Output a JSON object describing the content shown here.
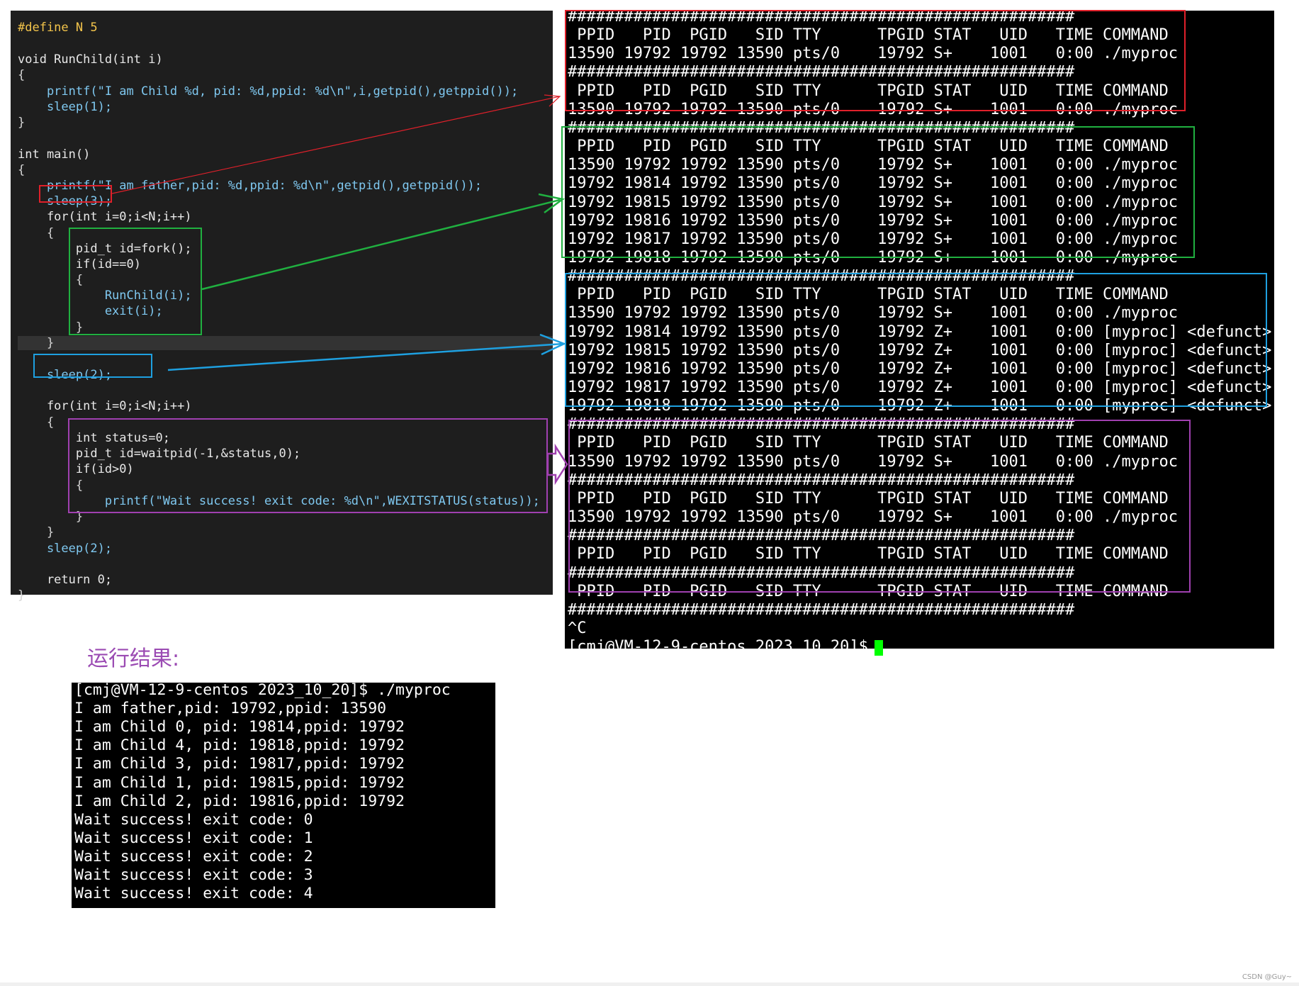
{
  "code": {
    "lines": [
      {
        "t": "#define N 5"
      },
      {
        "t": ""
      },
      {
        "t": "void RunChild(int i)"
      },
      {
        "t": "{"
      },
      {
        "t": "    printf(\"I am Child %d, pid: %d,ppid: %d\\n\",i,getpid(),getppid());"
      },
      {
        "t": "    sleep(1);"
      },
      {
        "t": "}"
      },
      {
        "t": ""
      },
      {
        "t": "int main()"
      },
      {
        "t": "{"
      },
      {
        "t": "    printf(\"I am father,pid: %d,ppid: %d\\n\",getpid(),getppid());"
      },
      {
        "t": "    sleep(3);"
      },
      {
        "t": "    for(int i=0;i<N;i++)"
      },
      {
        "t": "    {"
      },
      {
        "t": "        pid_t id=fork();"
      },
      {
        "t": "        if(id==0)"
      },
      {
        "t": "        {"
      },
      {
        "t": "            RunChild(i);"
      },
      {
        "t": "            exit(i);"
      },
      {
        "t": "        }"
      },
      {
        "t": ""
      },
      {
        "t": "    }"
      },
      {
        "t": "    sleep(2);"
      },
      {
        "t": ""
      },
      {
        "t": "    for(int i=0;i<N;i++)"
      },
      {
        "t": "    {"
      },
      {
        "t": "        int status=0;"
      },
      {
        "t": "        pid_t id=waitpid(-1,&status,0);"
      },
      {
        "t": "        if(id>0)"
      },
      {
        "t": "        {"
      },
      {
        "t": "            printf(\"Wait success! exit code: %d\\n\",WEXITSTATUS(status));"
      },
      {
        "t": "        }"
      },
      {
        "t": "    }"
      },
      {
        "t": "    sleep(2);"
      },
      {
        "t": ""
      },
      {
        "t": "    return 0;"
      },
      {
        "t": "}"
      }
    ]
  },
  "ps": {
    "lines": [
      "######################################################",
      " PPID   PID  PGID   SID TTY      TPGID STAT   UID   TIME COMMAND",
      "13590 19792 19792 13590 pts/0    19792 S+    1001   0:00 ./myproc",
      "######################################################",
      " PPID   PID  PGID   SID TTY      TPGID STAT   UID   TIME COMMAND",
      "13590 19792 19792 13590 pts/0    19792 S+    1001   0:00 ./myproc",
      "######################################################",
      " PPID   PID  PGID   SID TTY      TPGID STAT   UID   TIME COMMAND",
      "13590 19792 19792 13590 pts/0    19792 S+    1001   0:00 ./myproc",
      "19792 19814 19792 13590 pts/0    19792 S+    1001   0:00 ./myproc",
      "19792 19815 19792 13590 pts/0    19792 S+    1001   0:00 ./myproc",
      "19792 19816 19792 13590 pts/0    19792 S+    1001   0:00 ./myproc",
      "19792 19817 19792 13590 pts/0    19792 S+    1001   0:00 ./myproc",
      "19792 19818 19792 13590 pts/0    19792 S+    1001   0:00 ./myproc",
      "######################################################",
      " PPID   PID  PGID   SID TTY      TPGID STAT   UID   TIME COMMAND",
      "13590 19792 19792 13590 pts/0    19792 S+    1001   0:00 ./myproc",
      "19792 19814 19792 13590 pts/0    19792 Z+    1001   0:00 [myproc] <defunct>",
      "19792 19815 19792 13590 pts/0    19792 Z+    1001   0:00 [myproc] <defunct>",
      "19792 19816 19792 13590 pts/0    19792 Z+    1001   0:00 [myproc] <defunct>",
      "19792 19817 19792 13590 pts/0    19792 Z+    1001   0:00 [myproc] <defunct>",
      "19792 19818 19792 13590 pts/0    19792 Z+    1001   0:00 [myproc] <defunct>",
      "######################################################",
      " PPID   PID  PGID   SID TTY      TPGID STAT   UID   TIME COMMAND",
      "13590 19792 19792 13590 pts/0    19792 S+    1001   0:00 ./myproc",
      "######################################################",
      " PPID   PID  PGID   SID TTY      TPGID STAT   UID   TIME COMMAND",
      "13590 19792 19792 13590 pts/0    19792 S+    1001   0:00 ./myproc",
      "######################################################",
      " PPID   PID  PGID   SID TTY      TPGID STAT   UID   TIME COMMAND",
      "######################################################",
      " PPID   PID  PGID   SID TTY      TPGID STAT   UID   TIME COMMAND",
      "######################################################",
      "^C",
      "[cmj@VM-12-9-centos 2023_10_20]$ "
    ]
  },
  "run": {
    "title": "运行结果:",
    "lines": [
      "[cmj@VM-12-9-centos 2023_10_20]$ ./myproc",
      "I am father,pid: 19792,ppid: 13590",
      "I am Child 0, pid: 19814,ppid: 19792",
      "I am Child 4, pid: 19818,ppid: 19792",
      "I am Child 3, pid: 19817,ppid: 19792",
      "I am Child 1, pid: 19815,ppid: 19792",
      "I am Child 2, pid: 19816,ppid: 19792",
      "Wait success! exit code: 0",
      "Wait success! exit code: 1",
      "Wait success! exit code: 2",
      "Wait success! exit code: 3",
      "Wait success! exit code: 4"
    ]
  },
  "watermark": "CSDN @Guy~",
  "colors": {
    "red": "#e0202a",
    "green": "#20b040",
    "blue": "#1ea0e0",
    "purple": "#a040b0",
    "cursor": "#00ff00"
  }
}
